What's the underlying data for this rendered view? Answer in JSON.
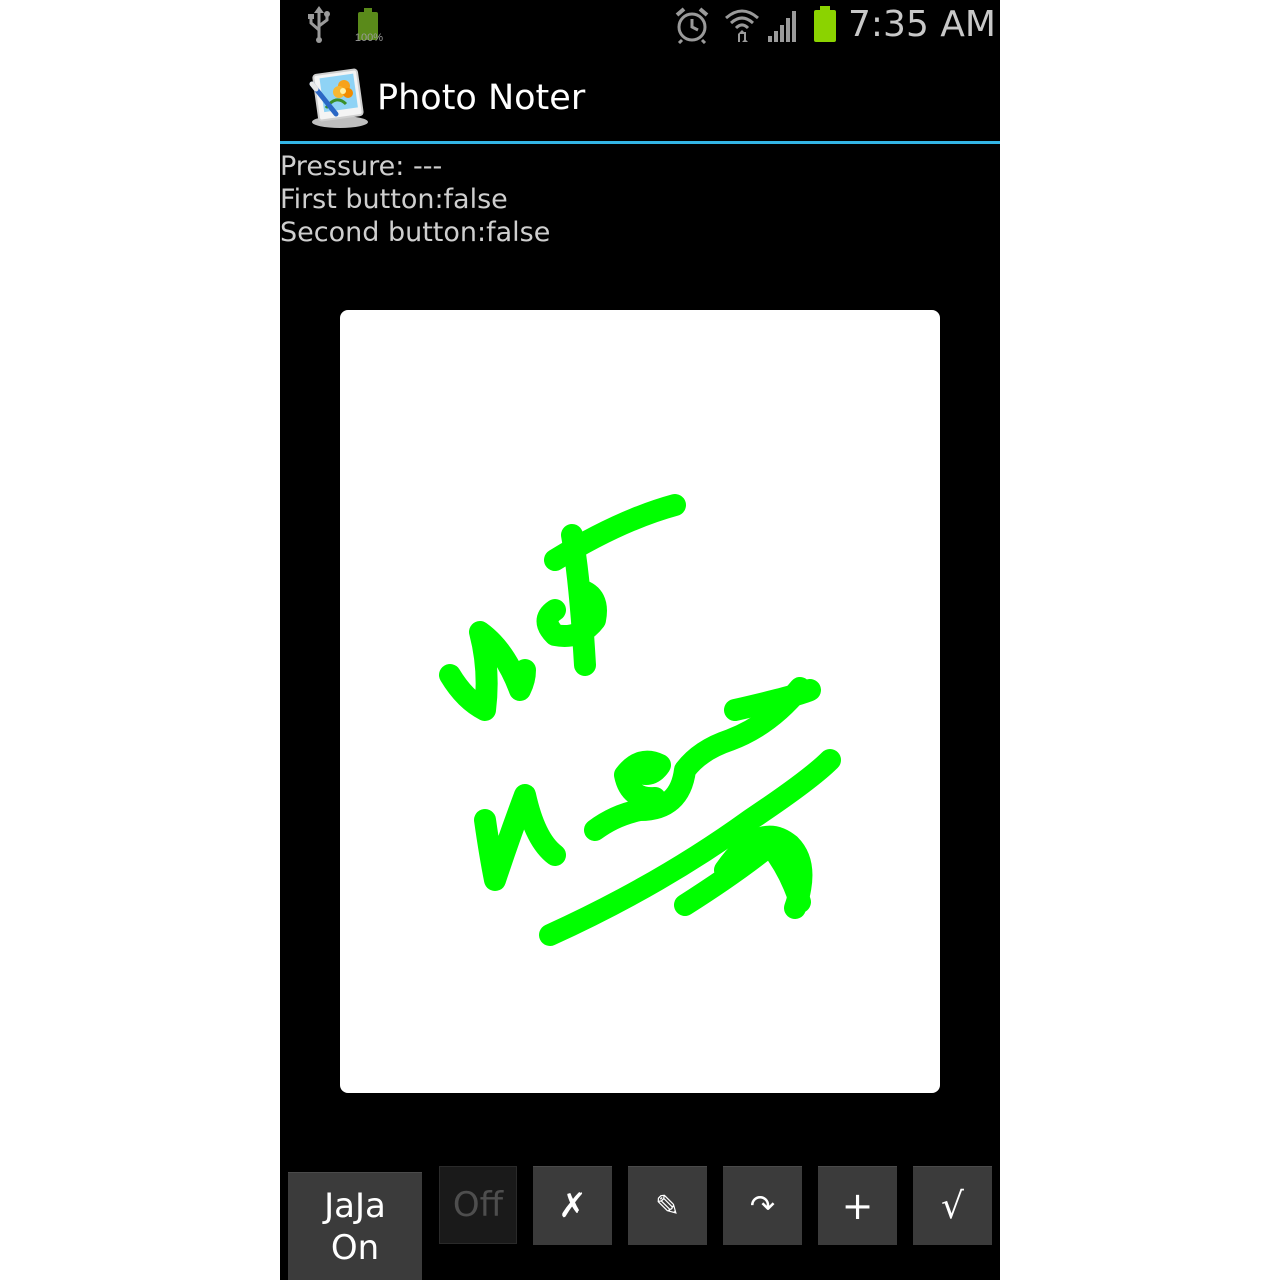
{
  "status_bar": {
    "battery_small_percent": "100%",
    "time": "7:35 AM",
    "icons": [
      "usb-icon",
      "battery-icon",
      "alarm-icon",
      "wifi-icon",
      "signal-icon",
      "battery-icon"
    ]
  },
  "action_bar": {
    "title": "Photo Noter",
    "icon": "photo-noter-app-icon"
  },
  "info": {
    "pressure": "Pressure: ---",
    "first_button": "First button:false",
    "second_button": "Second button:false"
  },
  "canvas": {
    "stroke_color": "#00ff00",
    "background": "#ffffff"
  },
  "toolbar": {
    "jaja_line1": "JaJa",
    "jaja_line2": "On",
    "off_label": "Off",
    "clear_label": "✗",
    "pencil_label": "✎",
    "redo_label": "↷",
    "add_label": "+",
    "done_label": "√"
  },
  "colors": {
    "accent": "#33b5e5",
    "battery": "#8bd300",
    "ink": "#00ff00"
  }
}
